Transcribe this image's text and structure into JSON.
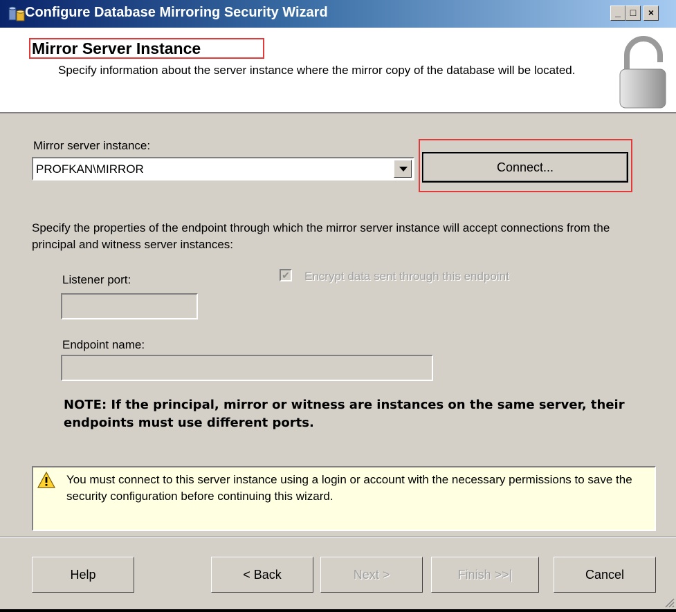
{
  "window": {
    "title": "Configure Database Mirroring Security Wizard",
    "controls": {
      "minimize": "_",
      "maximize": "□",
      "close": "×"
    }
  },
  "header": {
    "title": "Mirror Server Instance",
    "description": "Specify information about the server instance where the mirror copy of the database will be located."
  },
  "mirror": {
    "label": "Mirror server instance:",
    "value": "PROFKAN\\MIRROR",
    "connect_label": "Connect..."
  },
  "endpoint": {
    "description": "Specify the properties of the endpoint through which the mirror server instance will accept connections from the principal and witness server instances:",
    "listener_port_label": "Listener port:",
    "listener_port_value": "",
    "encrypt_label": "Encrypt data sent through this endpoint",
    "encrypt_checked": true,
    "endpoint_name_label": "Endpoint name:",
    "endpoint_name_value": "",
    "note": "NOTE: If the principal, mirror or witness are instances on the same server, their endpoints must use different ports."
  },
  "warning": {
    "icon": "warning-icon",
    "text": "You must connect to this server instance using a login or account with the necessary permissions to save the security configuration before continuing this wizard."
  },
  "buttons": {
    "help": "Help",
    "back": "< Back",
    "next": "Next >",
    "finish": "Finish >>|",
    "cancel": "Cancel"
  }
}
